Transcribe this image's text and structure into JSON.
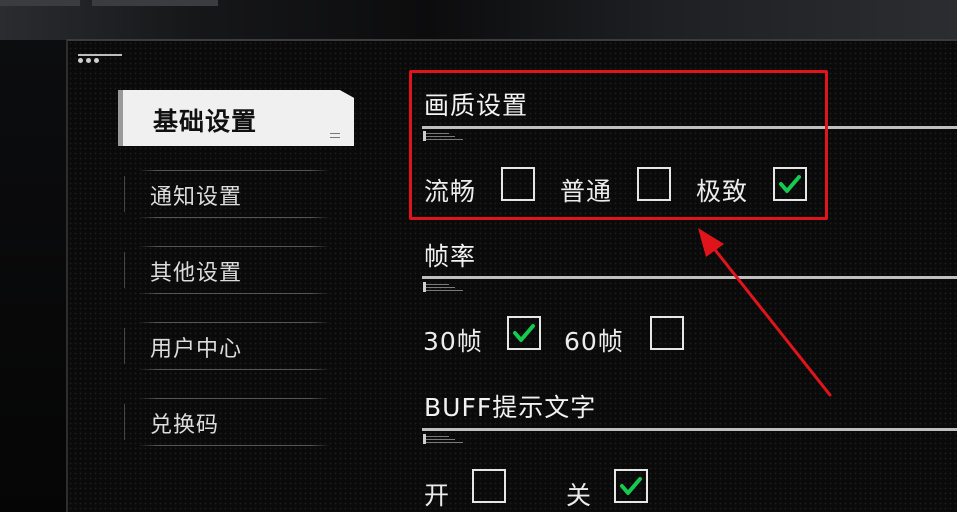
{
  "sidebar": {
    "items": [
      {
        "label": "基础设置",
        "active": true
      },
      {
        "label": "通知设置",
        "active": false
      },
      {
        "label": "其他设置",
        "active": false
      },
      {
        "label": "用户中心",
        "active": false
      },
      {
        "label": "兑换码",
        "active": false
      }
    ]
  },
  "settings": {
    "quality": {
      "title": "画质设置",
      "options": [
        {
          "label": "流畅",
          "checked": false
        },
        {
          "label": "普通",
          "checked": false
        },
        {
          "label": "极致",
          "checked": true
        }
      ]
    },
    "framerate": {
      "title": "帧率",
      "options": [
        {
          "label": "30帧",
          "checked": true
        },
        {
          "label": "60帧",
          "checked": false
        }
      ]
    },
    "buff_text": {
      "title": "BUFF提示文字",
      "options": [
        {
          "label": "开",
          "checked": false
        },
        {
          "label": "关",
          "checked": true
        }
      ]
    }
  },
  "colors": {
    "check": "#17c94f",
    "highlight": "#e0141b",
    "active_tab": "#f0f0f0"
  },
  "icons": {
    "checkmark": "check-icon",
    "annotation_arrow": "arrow-icon"
  }
}
